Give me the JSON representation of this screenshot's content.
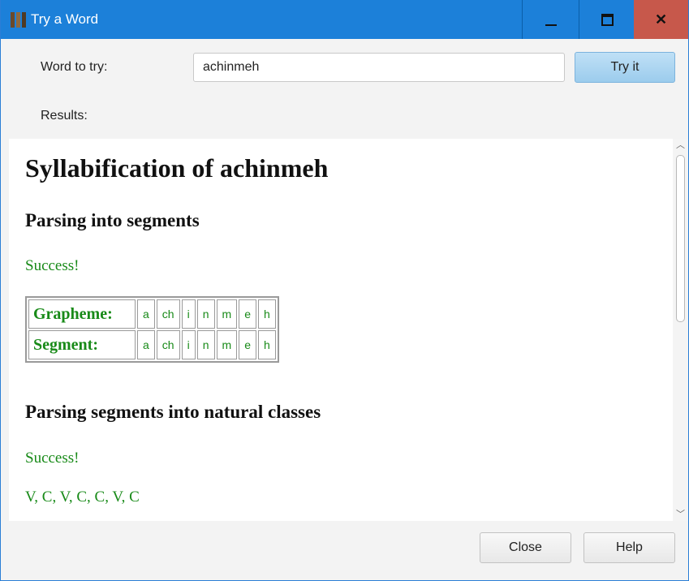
{
  "window": {
    "title": "Try a Word"
  },
  "form": {
    "word_label": "Word to try:",
    "word_value": "achinmeh",
    "try_label": "Try it",
    "results_label": "Results:"
  },
  "results": {
    "heading": "Syllabification of achinmeh",
    "section1_heading": "Parsing into segments",
    "section1_status": "Success!",
    "table": {
      "rows": [
        {
          "label": "Grapheme:",
          "cells": [
            "a",
            "ch",
            "i",
            "n",
            "m",
            "e",
            "h"
          ]
        },
        {
          "label": "Segment:",
          "cells": [
            "a",
            "ch",
            "i",
            "n",
            "m",
            "e",
            "h"
          ]
        }
      ]
    },
    "section2_heading": "Parsing segments into natural classes",
    "section2_status": "Success!",
    "natural_classes": "V, C, V, C, C, V, C"
  },
  "buttons": {
    "close": "Close",
    "help": "Help"
  },
  "colors": {
    "titlebar": "#1c80d9",
    "close_button": "#c7584b",
    "success_text": "#188a18"
  },
  "icons": [
    "app-icon",
    "minimize-icon",
    "maximize-icon",
    "close-icon",
    "scroll-up-icon",
    "scroll-down-icon"
  ]
}
